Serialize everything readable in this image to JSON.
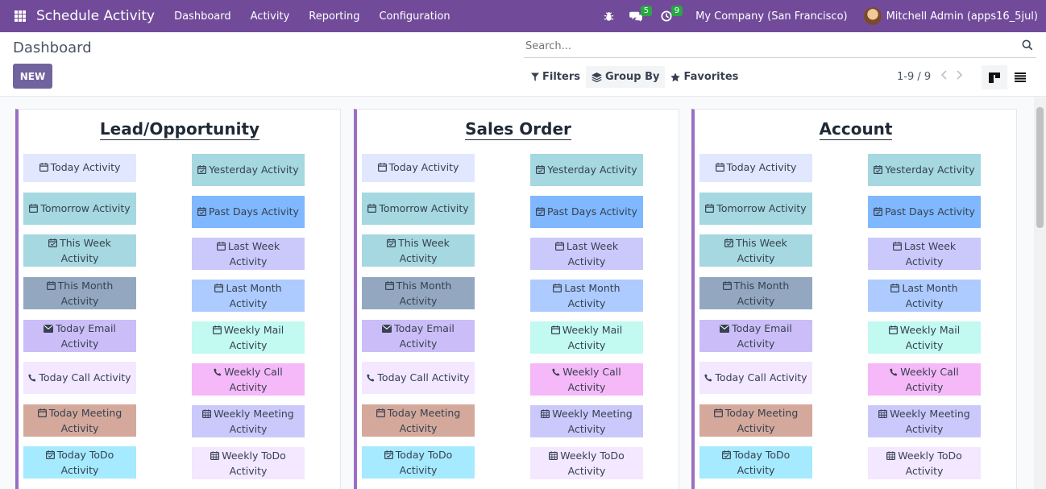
{
  "navbar": {
    "app_title": "Schedule Activity",
    "menu": [
      "Dashboard",
      "Activity",
      "Reporting",
      "Configuration"
    ],
    "messages_count": "5",
    "activities_count": "9",
    "company": "My Company (San Francisco)",
    "user": "Mitchell Admin (apps16_5jul)"
  },
  "control": {
    "breadcrumb": "Dashboard",
    "new_label": "NEW",
    "search_placeholder": "Search...",
    "filters_label": "Filters",
    "groupby_label": "Group By",
    "favorites_label": "Favorites",
    "pager": "1-9 / 9"
  },
  "buttons_left": [
    {
      "label": "Today Activity",
      "icon": "calendar-icon",
      "color": "#e0e7ff"
    },
    {
      "label": "Tomorrow Activity",
      "icon": "calendar-icon",
      "color": "#a5d8e0"
    },
    {
      "label": "This Week Activity",
      "icon": "calendar-check-icon",
      "color": "#a5d8e0"
    },
    {
      "label": "This Month Activity",
      "icon": "calendar-icon",
      "color": "#93a8c0"
    },
    {
      "label": "Today Email Activity",
      "icon": "envelope-icon",
      "color": "#cbbef8"
    },
    {
      "label": "Today Call Activity",
      "icon": "phone-icon",
      "color": "#f3e8ff"
    },
    {
      "label": "Today Meeting Activity",
      "icon": "calendar-icon",
      "color": "#d4a99b"
    },
    {
      "label": "Today ToDo Activity",
      "icon": "calendar-check-icon",
      "color": "#a5eaff"
    }
  ],
  "buttons_right": [
    {
      "label": "Yesterday Activity",
      "icon": "calendar-check-icon",
      "color": "#a5d8e0"
    },
    {
      "label": "Past Days Activity",
      "icon": "calendar-check-icon",
      "color": "#7fb8ff"
    },
    {
      "label": "Last Week Activity",
      "icon": "calendar-icon",
      "color": "#cbc9fb"
    },
    {
      "label": "Last Month Activity",
      "icon": "calendar-icon",
      "color": "#aecbff"
    },
    {
      "label": "Weekly Mail Activity",
      "icon": "calendar-icon",
      "color": "#c2f9f1"
    },
    {
      "label": "Weekly Call Activity",
      "icon": "phone-icon",
      "color": "#f5b8f8"
    },
    {
      "label": "Weekly Meeting Activity",
      "icon": "calendar-grid-icon",
      "color": "#cbc9fb"
    },
    {
      "label": "Weekly ToDo Activity",
      "icon": "calendar-grid-icon",
      "color": "#f3e8ff"
    }
  ],
  "cards": [
    {
      "title": "Lead/Opportunity"
    },
    {
      "title": "Sales Order"
    },
    {
      "title": "Account"
    }
  ]
}
